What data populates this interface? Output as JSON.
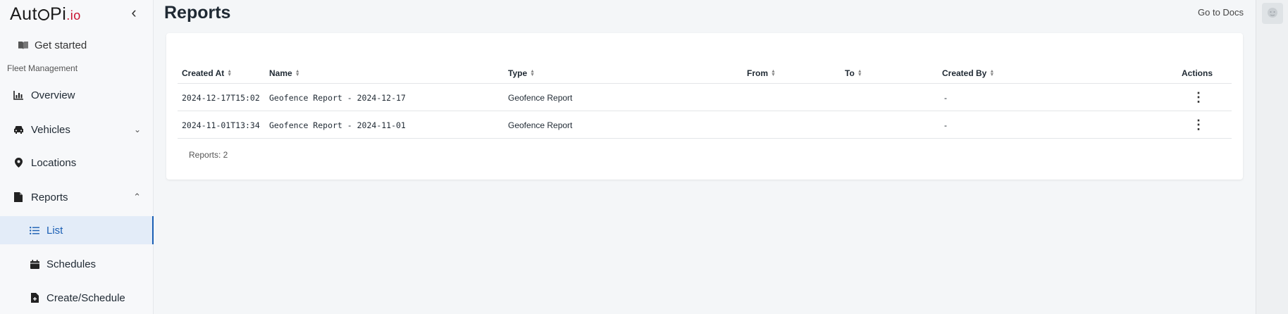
{
  "brand": {
    "name_part1": "Aut",
    "name_part2": "Pi",
    "name_io": ".io"
  },
  "sidebar": {
    "get_started": "Get started",
    "section_label": "Fleet Management",
    "items": [
      {
        "label": "Overview",
        "icon": "chart-icon"
      },
      {
        "label": "Vehicles",
        "icon": "car-icon",
        "expanded": false
      },
      {
        "label": "Locations",
        "icon": "map-pin-icon"
      },
      {
        "label": "Reports",
        "icon": "document-icon",
        "expanded": true
      }
    ],
    "sub_items": [
      {
        "label": "List",
        "icon": "list-icon",
        "active": true
      },
      {
        "label": "Schedules",
        "icon": "calendar-icon"
      },
      {
        "label": "Create/Schedule",
        "icon": "file-plus-icon"
      }
    ]
  },
  "header": {
    "title": "Reports",
    "docs_link": "Go to Docs"
  },
  "table": {
    "columns": [
      "Created At",
      "Name",
      "Type",
      "From",
      "To",
      "Created By",
      "Actions"
    ],
    "rows": [
      {
        "created_at": "2024-12-17T15:02",
        "name": "Geofence Report - 2024-12-17",
        "type": "Geofence Report",
        "from": "",
        "to": "",
        "created_by": "-"
      },
      {
        "created_at": "2024-11-01T13:34",
        "name": "Geofence Report - 2024-11-01",
        "type": "Geofence Report",
        "from": "",
        "to": "",
        "created_by": "-"
      }
    ],
    "footer": "Reports: 2"
  },
  "colors": {
    "accent": "#1a5fb4",
    "brand_red": "#c8102e",
    "active_bg": "#e3ecf8"
  }
}
